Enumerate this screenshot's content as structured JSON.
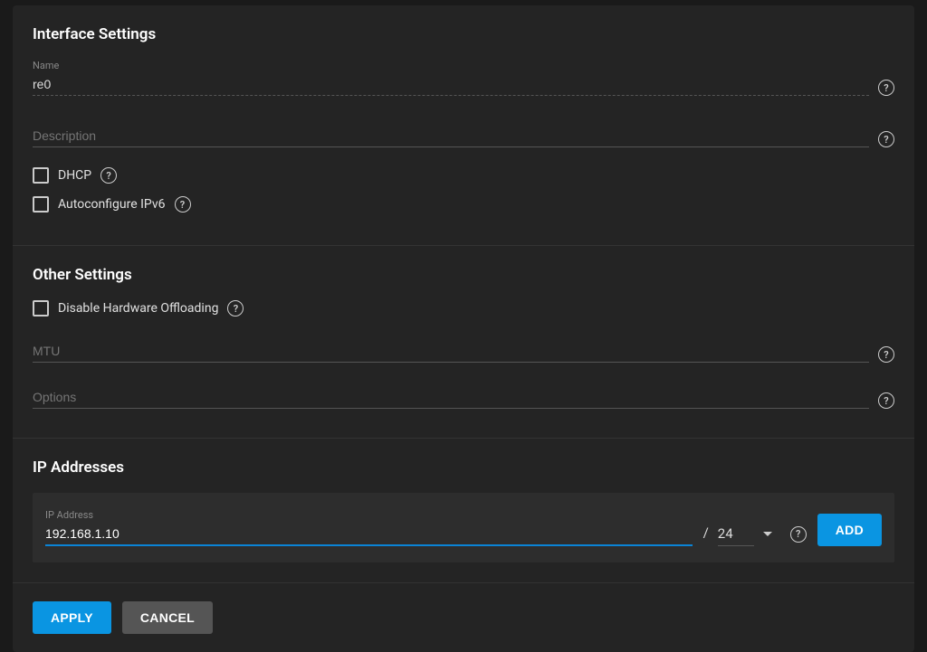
{
  "interface_settings": {
    "title": "Interface Settings",
    "name_label": "Name",
    "name_value": "re0",
    "description_label": "Description",
    "description_value": "",
    "dhcp_label": "DHCP",
    "dhcp_checked": false,
    "autoconf_label": "Autoconfigure IPv6",
    "autoconf_checked": false
  },
  "other_settings": {
    "title": "Other Settings",
    "hwoff_label": "Disable Hardware Offloading",
    "hwoff_checked": false,
    "mtu_label": "MTU",
    "mtu_value": "",
    "options_label": "Options",
    "options_value": ""
  },
  "ip_addresses": {
    "title": "IP Addresses",
    "ip_label": "IP Address",
    "ip_value": "192.168.1.10",
    "cidr_value": "24",
    "add_label": "Add"
  },
  "footer": {
    "apply": "Apply",
    "cancel": "Cancel"
  }
}
